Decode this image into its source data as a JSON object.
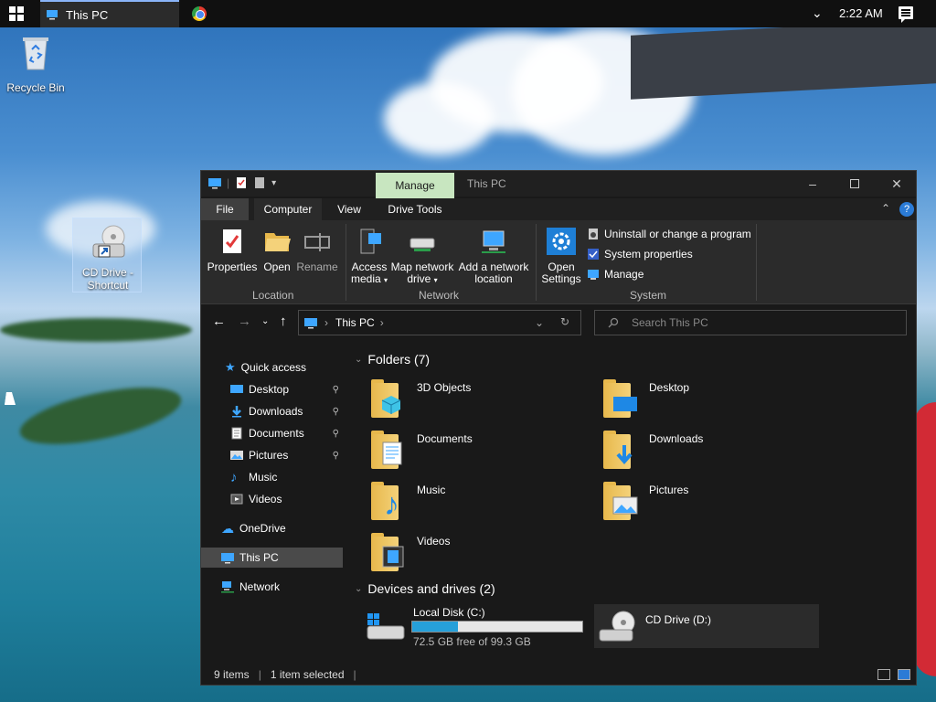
{
  "taskbar": {
    "task_label": "This PC",
    "clock": "2:22 AM"
  },
  "desktop": {
    "recycle_bin": "Recycle Bin",
    "cd_shortcut": "CD Drive - Shortcut"
  },
  "window": {
    "title": "This PC",
    "contextual_tab": "Manage",
    "tabs": [
      {
        "label": "File"
      },
      {
        "label": "Computer"
      },
      {
        "label": "View"
      },
      {
        "label": "Drive Tools"
      }
    ],
    "ribbon": {
      "location": {
        "label": "Location",
        "properties": "Properties",
        "open": "Open",
        "rename": "Rename"
      },
      "network": {
        "label": "Network",
        "access_media": "Access media",
        "map_drive": "Map network drive",
        "add_location": "Add a network location"
      },
      "system": {
        "label": "System",
        "open_settings": "Open Settings",
        "uninstall": "Uninstall or change a program",
        "system_properties": "System properties",
        "manage": "Manage"
      }
    },
    "address": {
      "path": "This PC",
      "search_placeholder": "Search This PC"
    },
    "nav": {
      "quick_access": "Quick access",
      "items": [
        {
          "label": "Desktop"
        },
        {
          "label": "Downloads"
        },
        {
          "label": "Documents"
        },
        {
          "label": "Pictures"
        },
        {
          "label": "Music"
        },
        {
          "label": "Videos"
        }
      ],
      "onedrive": "OneDrive",
      "this_pc": "This PC",
      "network": "Network"
    },
    "folders_header": "Folders (7)",
    "folders": [
      {
        "name": "3D Objects"
      },
      {
        "name": "Desktop"
      },
      {
        "name": "Documents"
      },
      {
        "name": "Downloads"
      },
      {
        "name": "Music"
      },
      {
        "name": "Pictures"
      },
      {
        "name": "Videos"
      }
    ],
    "drives_header": "Devices and drives (2)",
    "drives": [
      {
        "name": "Local Disk (C:)",
        "free": "72.5 GB free of 99.3 GB",
        "used_fraction": 0.27
      },
      {
        "name": "CD Drive (D:)"
      }
    ],
    "status": {
      "items": "9 items",
      "selected": "1 item selected"
    }
  },
  "colors": {
    "accent": "#26a0da",
    "manage_tab": "#c8e6c0",
    "folder": "#e7b84c"
  }
}
